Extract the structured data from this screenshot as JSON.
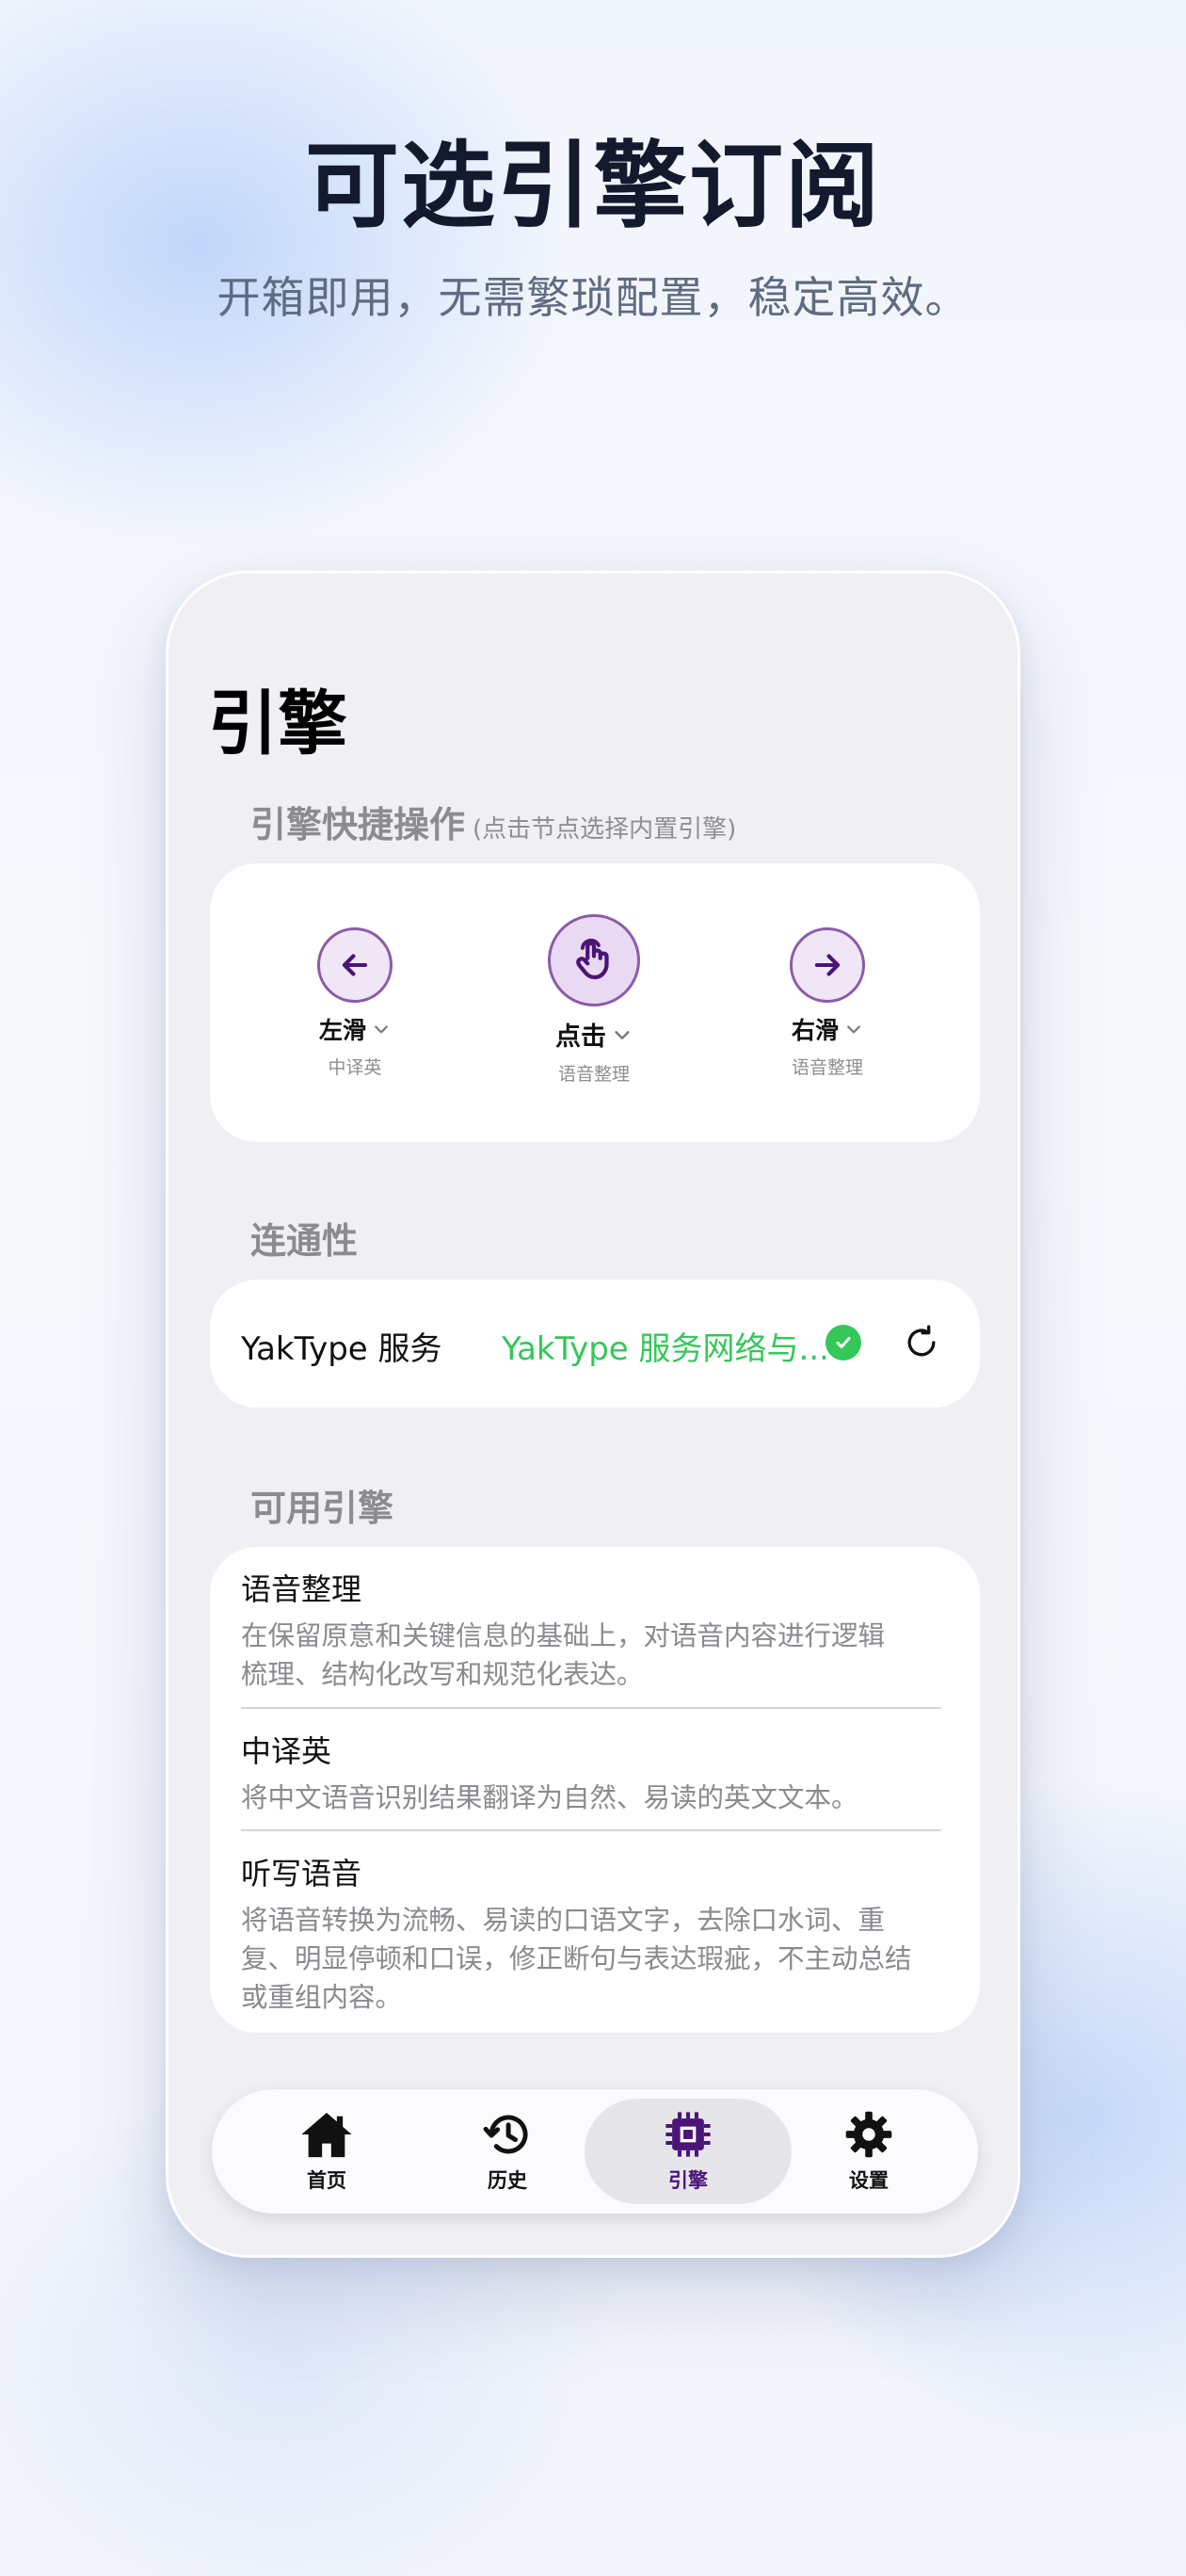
{
  "promo": {
    "headline": "可选引擎订阅",
    "subhead": "开箱即用，无需繁琐配置，稳定高效。"
  },
  "screen": {
    "title": "引擎"
  },
  "gestures": {
    "section_title": "引擎快捷操作",
    "section_hint": "(点击节点选择内置引擎)",
    "items": [
      {
        "name": "左滑",
        "engine": "中译英",
        "icon": "arrow-left-icon"
      },
      {
        "name": "点击",
        "engine": "语音整理",
        "icon": "tap-hand-icon"
      },
      {
        "name": "右滑",
        "engine": "语音整理",
        "icon": "arrow-right-icon"
      }
    ]
  },
  "connectivity": {
    "section_title": "连通性",
    "service": "YakType 服务",
    "status": "YakType 服务网络与...",
    "status_icon": "check-circle-icon",
    "action_icon": "refresh-icon"
  },
  "engines": {
    "section_title": "可用引擎",
    "items": [
      {
        "name": "语音整理",
        "desc_line1": "在保留原意和关键信息的基础上，对语音内容进行逻辑",
        "desc_line2": "梳理、结构化改写和规范化表达。"
      },
      {
        "name": "中译英",
        "desc_line1": "将中文语音识别结果翻译为自然、易读的英文文本。"
      },
      {
        "name": "听写语音",
        "desc_line1": "将语音转换为流畅、易读的口语文字，去除口水词、重",
        "desc_line2": "复、明显停顿和口误，修正断句与表达瑕疵，不主动总结",
        "desc_line3": "或重组内容。"
      }
    ]
  },
  "tabbar": {
    "tabs": [
      {
        "label": "首页",
        "icon": "home-icon"
      },
      {
        "label": "历史",
        "icon": "history-icon"
      },
      {
        "label": "引擎",
        "icon": "chip-icon",
        "active": true
      },
      {
        "label": "设置",
        "icon": "gear-icon"
      }
    ]
  },
  "colors": {
    "accent": "#4a1577",
    "accent_border": "#8b5ca7",
    "success": "#34c759"
  }
}
